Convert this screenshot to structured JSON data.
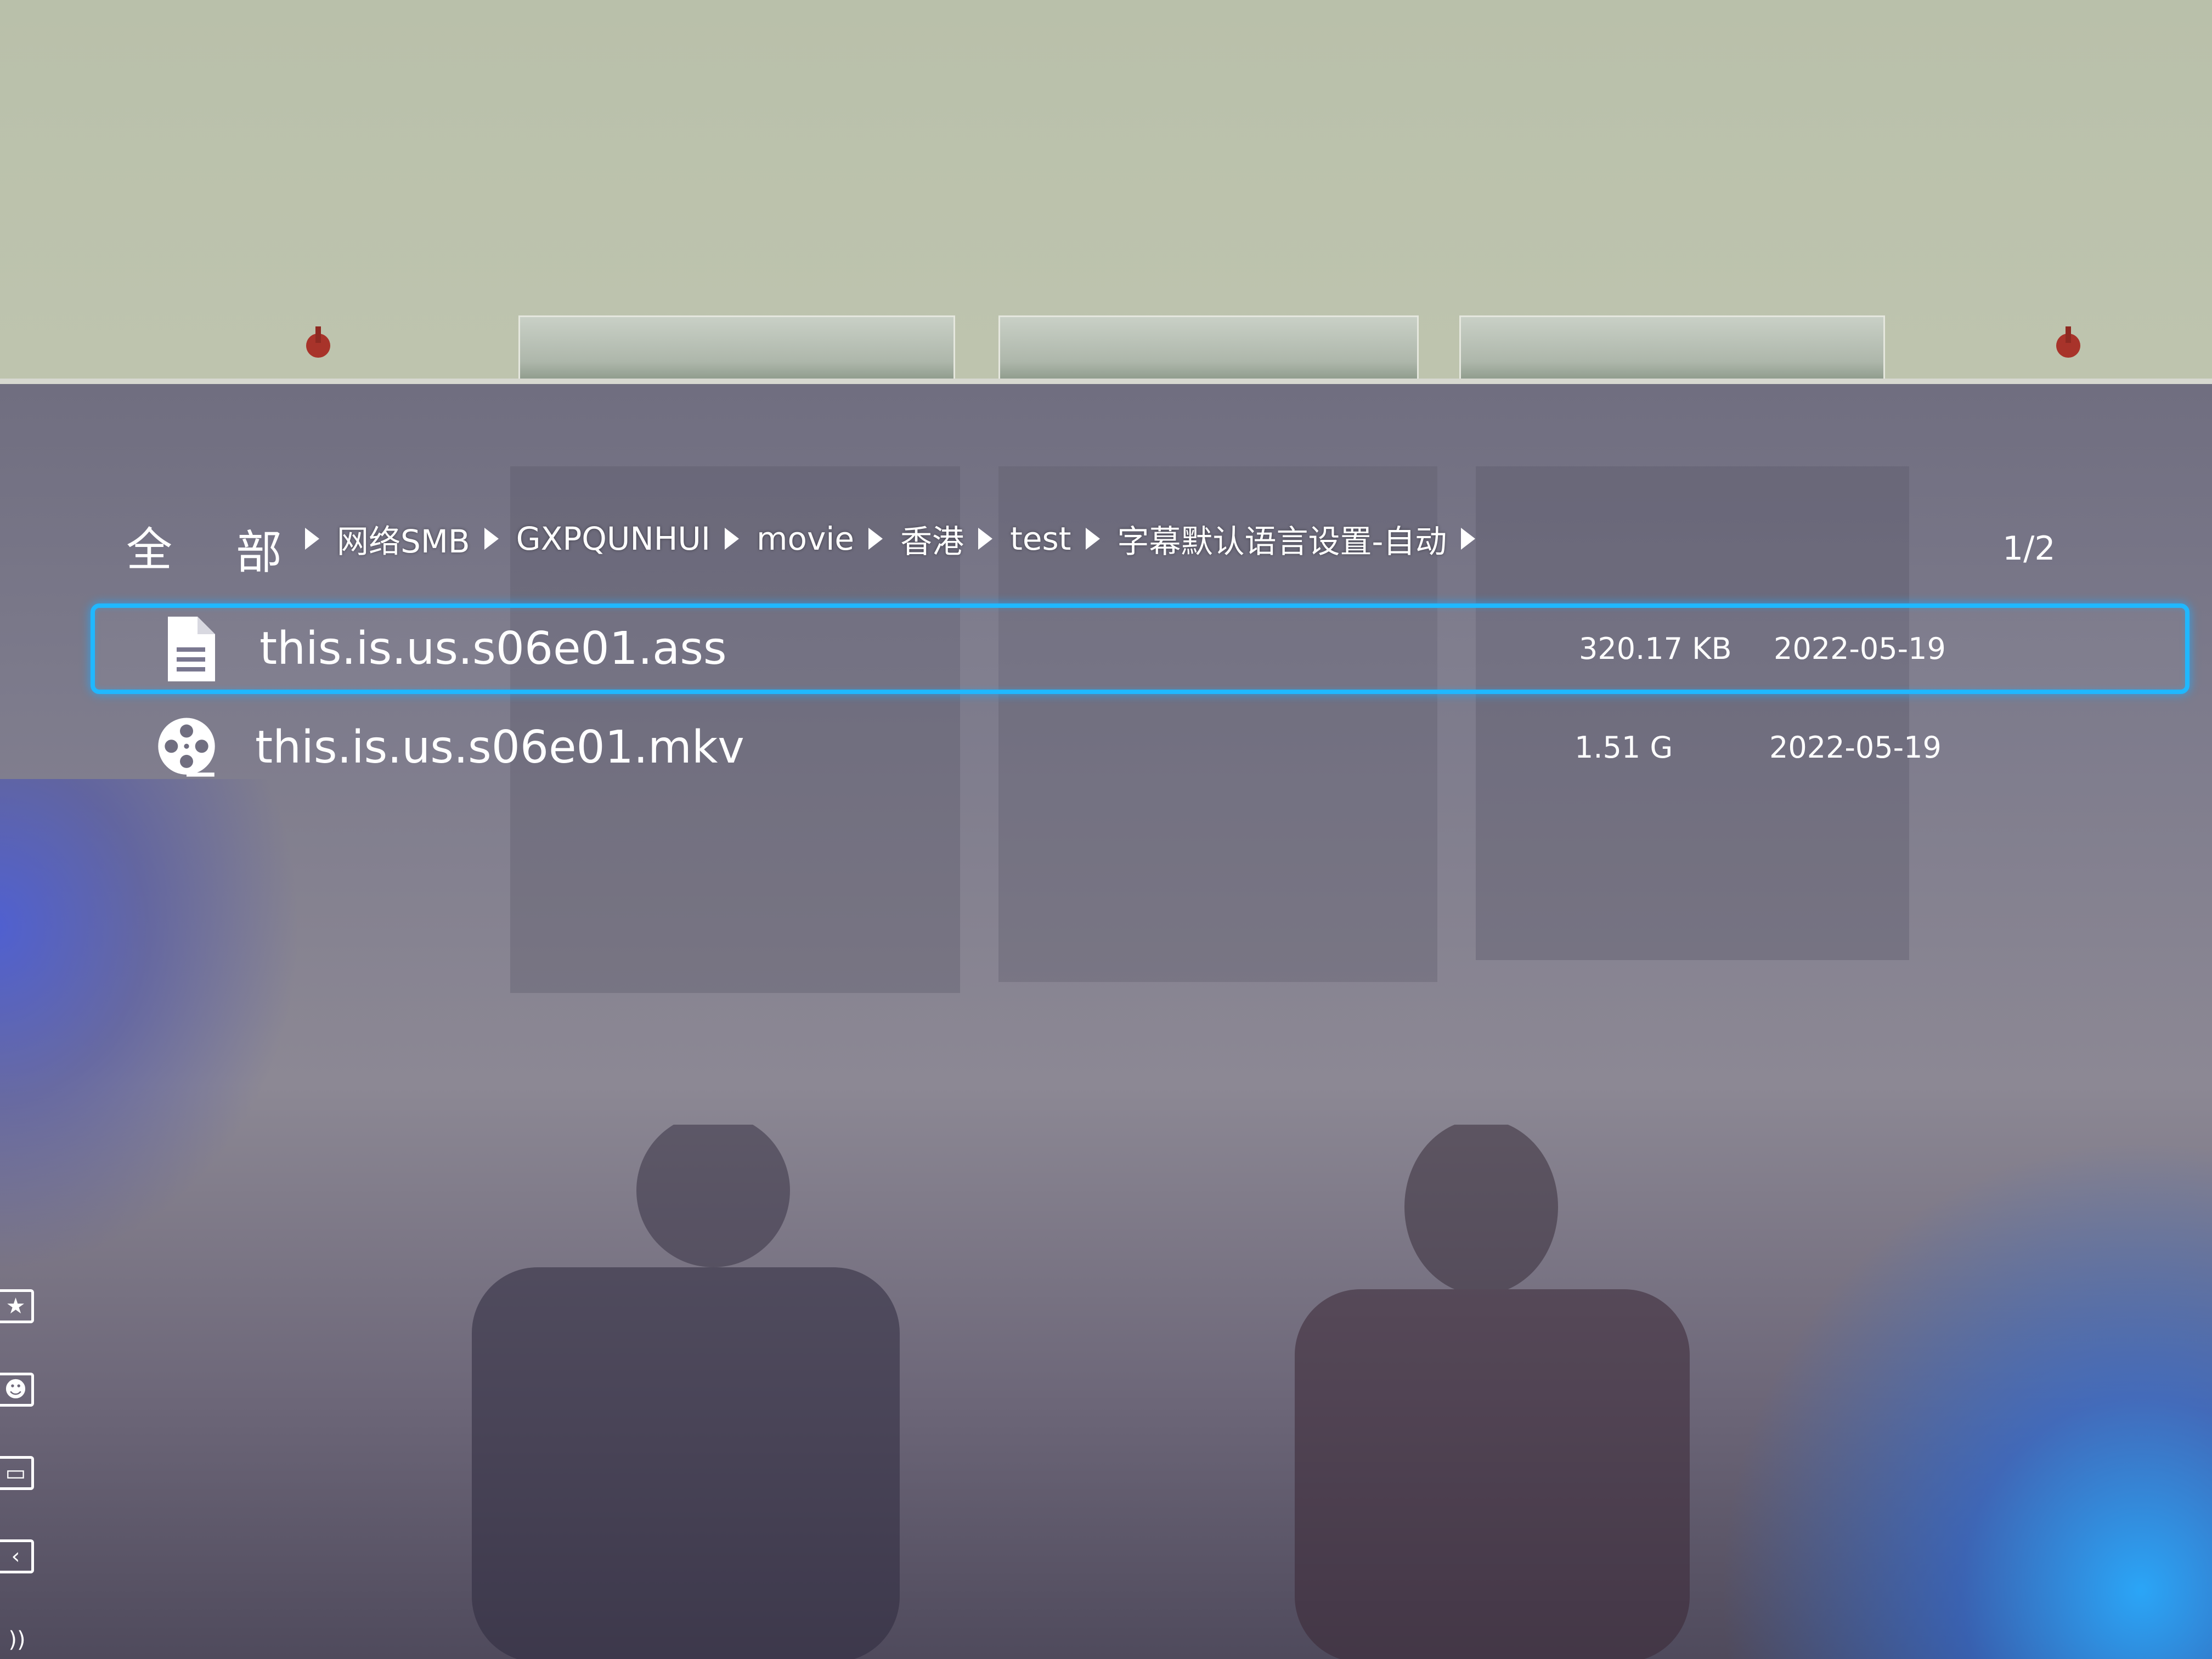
{
  "breadcrumb": {
    "root_a": "全",
    "root_b": "部",
    "items": [
      {
        "label": "网络SMB"
      },
      {
        "label": "GXPQUNHUI"
      },
      {
        "label": "movie"
      },
      {
        "label": "香港"
      },
      {
        "label": "test"
      },
      {
        "label": "字幕默认语言设置-自动"
      }
    ]
  },
  "pager": "1/2",
  "files": [
    {
      "name": "this.is.us.s06e01.ass",
      "size": "320.17 KB",
      "date": "2022-05-19",
      "icon": "document-icon",
      "selected": true
    },
    {
      "name": "this.is.us.s06e01.mkv",
      "size": "1.51 G",
      "date": "2022-05-19",
      "icon": "film-reel-icon",
      "selected": false
    }
  ],
  "side_icons": [
    "star-icon",
    "person-icon",
    "devices-icon",
    "back-icon",
    "audio-icon"
  ],
  "colors": {
    "selection": "#20b8ff",
    "text": "#ffffff"
  }
}
